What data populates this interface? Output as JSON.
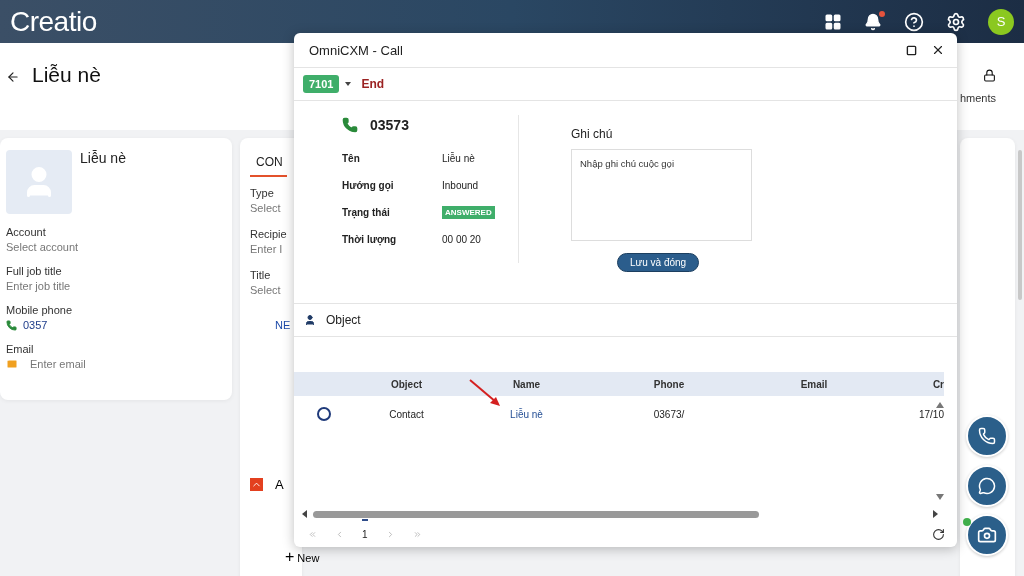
{
  "header": {
    "logo": "Creatio",
    "avatar": "S",
    "notifications_unread": true
  },
  "page": {
    "title": "Liễu nè",
    "side_tab": "hments"
  },
  "profile": {
    "name": "Liễu nè",
    "fields": [
      {
        "label": "Account",
        "placeholder": "Select account",
        "kind": "text"
      },
      {
        "label": "Full job title",
        "placeholder": "Enter job title",
        "kind": "text"
      },
      {
        "label": "Mobile phone",
        "value": "0357",
        "kind": "phone"
      },
      {
        "label": "Email",
        "placeholder": "Enter email",
        "kind": "email"
      }
    ]
  },
  "details": {
    "tabs": [
      {
        "label": "CON",
        "selected": true
      }
    ],
    "fields": [
      {
        "label": "Type",
        "placeholder": "Select"
      },
      {
        "label": "Recipie",
        "placeholder": "Enter I"
      },
      {
        "label": "Title",
        "placeholder": "Select"
      }
    ],
    "link": "NE",
    "section": {
      "label": "A",
      "expanded": true
    },
    "add": {
      "icon": "+",
      "label": "New"
    }
  },
  "dialog": {
    "title": "OmniCXM - Call",
    "extension": "7101",
    "end": "End",
    "call": {
      "number": "03573",
      "rows": [
        {
          "label": "Tên",
          "value": "Liễu nè",
          "kind": "text"
        },
        {
          "label": "Hướng gọi",
          "value": "Inbound",
          "kind": "text"
        },
        {
          "label": "Trạng thái",
          "value": "ANSWERED",
          "kind": "status"
        },
        {
          "label": "Thời lượng",
          "value": "00 00 20",
          "kind": "text"
        }
      ]
    },
    "note": {
      "title": "Ghi chú",
      "placeholder": "Nhập ghi chú cuộc gọi",
      "button": "Lưu và đóng"
    },
    "object": {
      "title": "Object",
      "columns": [
        "Object",
        "Name",
        "Phone",
        "Email",
        "Cr"
      ],
      "rows": [
        {
          "selected": false,
          "object": "Contact",
          "name": "Liễu nè",
          "phone": "03673/",
          "created": "17/10"
        }
      ],
      "page": "1"
    }
  }
}
